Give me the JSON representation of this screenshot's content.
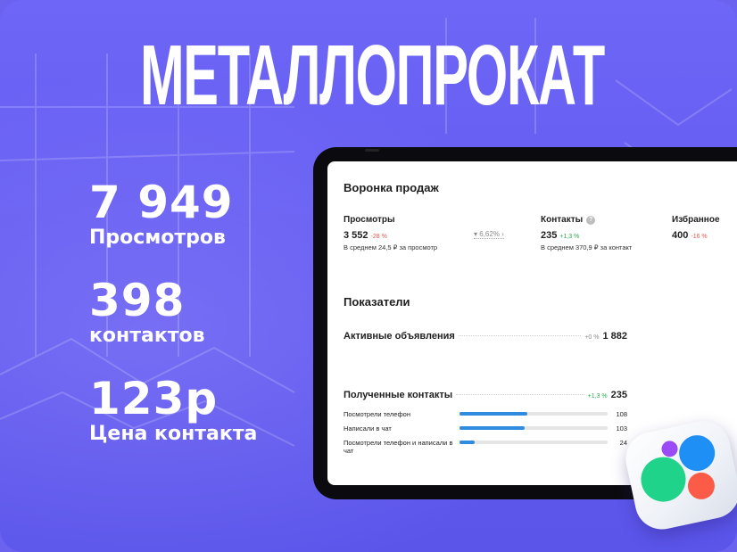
{
  "headline": "МЕТАЛЛОПРОКАТ",
  "stats": [
    {
      "value": "7 949",
      "label": "Просмотров"
    },
    {
      "value": "398",
      "label": "контактов"
    },
    {
      "value": "123р",
      "label": "Цена контакта"
    }
  ],
  "funnel": {
    "title": "Воронка продаж",
    "conversion": "6,62% ›",
    "columns": [
      {
        "title": "Просмотры",
        "value": "3 552",
        "delta": "-28 %",
        "delta_color": "red",
        "sub": "В среднем 24,5 ₽ за просмотр"
      },
      {
        "title": "Контакты",
        "value": "235",
        "delta": "+1,3 %",
        "delta_color": "green",
        "sub": "В среднем 370,9 ₽ за контакт"
      },
      {
        "title": "Избранное",
        "value": "400",
        "delta": "-16 %",
        "delta_color": "red",
        "sub": ""
      }
    ]
  },
  "indicators": {
    "title": "Показатели",
    "active_ads": {
      "name": "Активные объявления",
      "delta": "+0 %",
      "value": "1 882"
    },
    "received_contacts": {
      "name": "Полученные контакты",
      "delta": "+1,3 %",
      "value": "235"
    },
    "bars": [
      {
        "label": "Посмотрели телефон",
        "value": "108",
        "fraction": 0.46
      },
      {
        "label": "Написали в чат",
        "value": "103",
        "fraction": 0.44
      },
      {
        "label": "Посмотрели телефон и написали в чат",
        "value": "24",
        "fraction": 0.1
      }
    ]
  },
  "colors": {
    "background": "#6b63f0",
    "accent_blue": "#2f8bdf",
    "green": "#2bab4f",
    "red": "#e05a4f"
  },
  "icons": [
    "info-icon",
    "filter-icon",
    "app-logo-icon"
  ]
}
